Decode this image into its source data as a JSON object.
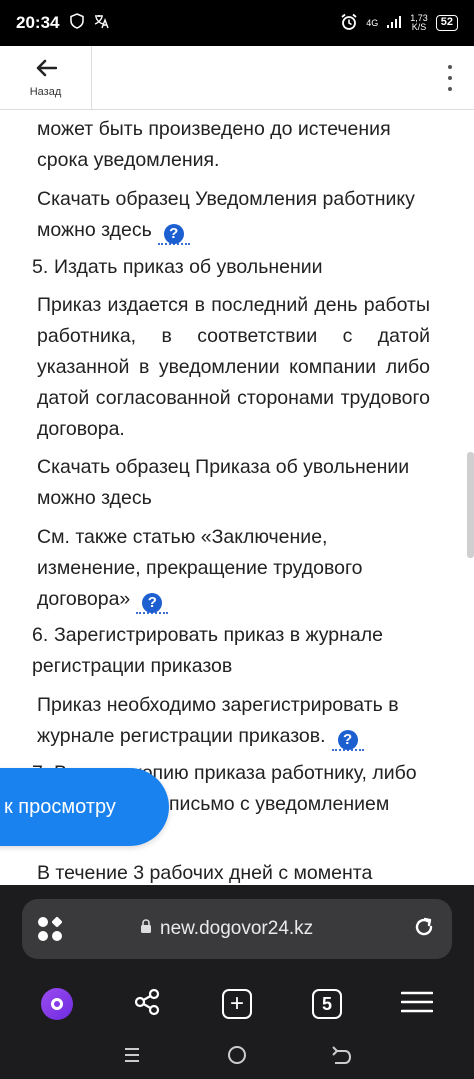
{
  "status_bar": {
    "time": "20:34",
    "network_type": "4G",
    "speed_value": "1,73",
    "speed_unit": "K/S",
    "battery": "52"
  },
  "header": {
    "back_label": "Назад"
  },
  "content": {
    "p1": "может быть произведено до истечения срока уведомления.",
    "p2": "Скачать образец Уведомления работнику можно здесь",
    "step5_num": "5.",
    "step5_title": "Издать приказ об увольнении",
    "p3": "Приказ издается в последний день работы работника, в соответствии с датой указанной в уведомлении компании либо датой согласованной сторонами трудового договора.",
    "p4": "Скачать образец Приказа об увольнении можно здесь",
    "p5": "См. также статью «Заключение, изменение, прекращение трудового договора»",
    "step6_num": "6.",
    "step6_title": "Зарегистрировать приказ в журнале регистрации приказов",
    "p6": "Приказ необходимо зарегистрировать в журнале регистрации приказов.",
    "step7_num": "7.",
    "step7_title": "Вручить копию приказа работнику, либо отправить ему письмо с уведомлением",
    "p7": "В течение 3 рабочих дней с момента",
    "help_symbol": "?"
  },
  "preview_button": {
    "label": "к просмотру"
  },
  "browser": {
    "url": "new.dogovor24.kz",
    "tabs_count": "5",
    "add_symbol": "+"
  }
}
